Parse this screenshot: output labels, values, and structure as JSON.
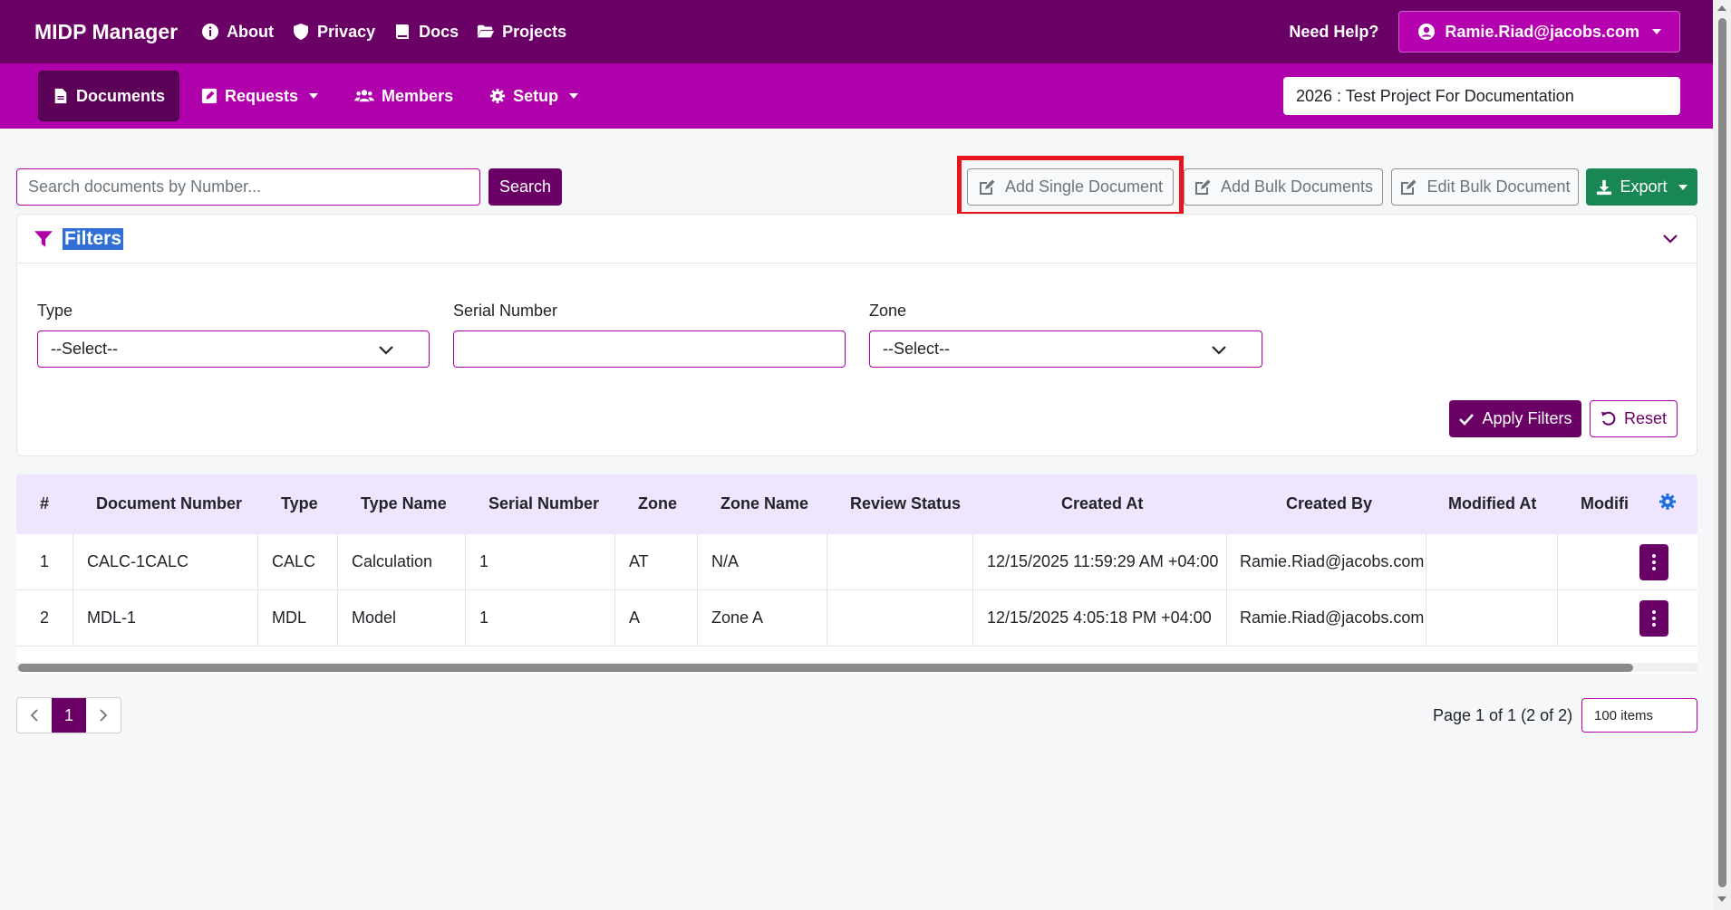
{
  "topbar": {
    "brand": "MIDP Manager",
    "nav": [
      {
        "label": "About",
        "icon": "info-circle-icon"
      },
      {
        "label": "Privacy",
        "icon": "shield-icon"
      },
      {
        "label": "Docs",
        "icon": "book-icon"
      },
      {
        "label": "Projects",
        "icon": "folder-open-icon"
      }
    ],
    "need_help": "Need Help?",
    "user": "Ramie.Riad@jacobs.com"
  },
  "subnav": {
    "items": [
      {
        "label": "Documents",
        "icon": "file-icon",
        "active": true
      },
      {
        "label": "Requests",
        "icon": "edit-square-icon",
        "dropdown": true
      },
      {
        "label": "Members",
        "icon": "users-icon"
      },
      {
        "label": "Setup",
        "icon": "gear-icon",
        "dropdown": true
      }
    ],
    "project": "2026 : Test Project For Documentation"
  },
  "toolbar": {
    "search_placeholder": "Search documents by Number...",
    "search_label": "Search",
    "add_single": "Add Single Document",
    "add_bulk": "Add Bulk Documents",
    "edit_bulk": "Edit Bulk Document",
    "export": "Export"
  },
  "filters": {
    "title": "Filters",
    "type_label": "Type",
    "type_value": "--Select--",
    "serial_label": "Serial Number",
    "serial_value": "",
    "zone_label": "Zone",
    "zone_value": "--Select--",
    "apply": "Apply Filters",
    "reset": "Reset"
  },
  "table": {
    "headers": [
      "#",
      "Document Number",
      "Type",
      "Type Name",
      "Serial Number",
      "Zone",
      "Zone Name",
      "Review Status",
      "Created At",
      "Created By",
      "Modified At",
      "Modifi"
    ],
    "rows": [
      [
        "1",
        "CALC-1CALC",
        "CALC",
        "Calculation",
        "1",
        "AT",
        "N/A",
        "",
        "12/15/2025 11:59:29 AM +04:00",
        "Ramie.Riad@jacobs.com",
        "",
        ""
      ],
      [
        "2",
        "MDL-1",
        "MDL",
        "Model",
        "1",
        "A",
        "Zone A",
        "",
        "12/15/2025 4:05:18 PM +04:00",
        "Ramie.Riad@jacobs.com",
        "",
        ""
      ]
    ]
  },
  "pagination": {
    "current": "1",
    "info": "Page 1 of 1 (2 of 2)",
    "page_size": "100 items"
  },
  "colors": {
    "primary_dark": "#6a0066",
    "primary": "#b000ac",
    "success": "#198754",
    "highlight": "#e8131c"
  }
}
